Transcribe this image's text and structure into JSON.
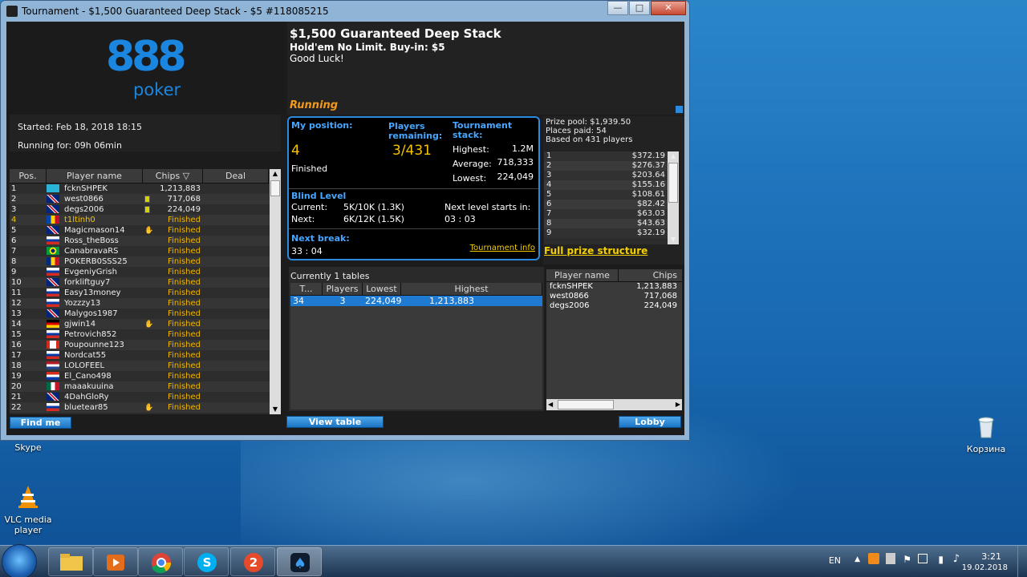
{
  "window": {
    "title": "Tournament - $1,500 Guaranteed Deep Stack - $5 #118085215",
    "minimize": "—",
    "maximize": "□",
    "close": "✕"
  },
  "logo": {
    "mark": "888",
    "word": "poker"
  },
  "tournament": {
    "name": "$1,500 Guaranteed Deep Stack",
    "game": "Hold'em No Limit. Buy-in: $5",
    "message": "Good Luck!",
    "state": "Running",
    "started": "Started: Feb 18, 2018 18:15",
    "running_for": "Running for: 09h 06min"
  },
  "player_list": {
    "headers": [
      "Pos.",
      "Player name",
      "Chips",
      "Deal"
    ],
    "rows": [
      {
        "pos": "1",
        "name": "fcknSHPEK",
        "chips": "1,213,883",
        "flag": "kz"
      },
      {
        "pos": "2",
        "name": "west0866",
        "chips": "717,068",
        "flag": "uk",
        "note": true
      },
      {
        "pos": "3",
        "name": "degs2006",
        "chips": "224,049",
        "flag": "uk",
        "note": true
      },
      {
        "pos": "4",
        "name": "t1ltinh0",
        "chips": "Finished",
        "flag": "md",
        "me": true
      },
      {
        "pos": "5",
        "name": "Magicmason14",
        "chips": "Finished",
        "flag": "uk",
        "deal": true
      },
      {
        "pos": "6",
        "name": "Ross_theBoss",
        "chips": "Finished",
        "flag": "ru"
      },
      {
        "pos": "7",
        "name": "CanabravaRS",
        "chips": "Finished",
        "flag": "br"
      },
      {
        "pos": "8",
        "name": "POKERB0SSS25",
        "chips": "Finished",
        "flag": "ro"
      },
      {
        "pos": "9",
        "name": "EvgeniyGrish",
        "chips": "Finished",
        "flag": "ru"
      },
      {
        "pos": "10",
        "name": "forkliftguy7",
        "chips": "Finished",
        "flag": "uk"
      },
      {
        "pos": "11",
        "name": "Easy13money",
        "chips": "Finished",
        "flag": "ru"
      },
      {
        "pos": "12",
        "name": "Yozzzy13",
        "chips": "Finished",
        "flag": "ru"
      },
      {
        "pos": "13",
        "name": "Malygos1987",
        "chips": "Finished",
        "flag": "uk"
      },
      {
        "pos": "14",
        "name": "gjwin14",
        "chips": "Finished",
        "flag": "de",
        "deal": true
      },
      {
        "pos": "15",
        "name": "Petrovich852",
        "chips": "Finished",
        "flag": "ru"
      },
      {
        "pos": "16",
        "name": "Poupounne123",
        "chips": "Finished",
        "flag": "ca"
      },
      {
        "pos": "17",
        "name": "Nordcat55",
        "chips": "Finished",
        "flag": "ru"
      },
      {
        "pos": "18",
        "name": "LOLOFEEL",
        "chips": "Finished",
        "flag": "nl"
      },
      {
        "pos": "19",
        "name": "El_Cano498",
        "chips": "Finished",
        "flag": "py"
      },
      {
        "pos": "20",
        "name": "maaakuuina",
        "chips": "Finished",
        "flag": "mx"
      },
      {
        "pos": "21",
        "name": "4DahGloRy",
        "chips": "Finished",
        "flag": "uk"
      },
      {
        "pos": "22",
        "name": "bluetear85",
        "chips": "Finished",
        "flag": "ru",
        "deal": true
      }
    ],
    "find_me": "Find me"
  },
  "status": {
    "my_position_label": "My position:",
    "my_position": "4",
    "my_status": "Finished",
    "players_remaining_label": "Players remaining:",
    "players_remaining": "3/431",
    "stack_label": "Tournament stack:",
    "highest_label": "Highest:",
    "highest": "1.2M",
    "average_label": "Average:",
    "average": "718,333",
    "lowest_label": "Lowest:",
    "lowest": "224,049",
    "blind_label": "Blind Level",
    "current_label": "Current:",
    "current": "5K/10K (1.3K)",
    "next_label": "Next:",
    "next": "6K/12K (1.5K)",
    "next_level_label": "Next level starts in:",
    "next_level": "03 : 03",
    "break_label": "Next break:",
    "break": "33 : 04",
    "info_link": "Tournament info"
  },
  "prize": {
    "pool": "Prize pool: $1,939.50",
    "places": "Places paid: 54",
    "based": "Based on 431 players",
    "rows": [
      {
        "p": "1",
        "v": "$372.19"
      },
      {
        "p": "2",
        "v": "$276.37"
      },
      {
        "p": "3",
        "v": "$203.64"
      },
      {
        "p": "4",
        "v": "$155.16"
      },
      {
        "p": "5",
        "v": "$108.61"
      },
      {
        "p": "6",
        "v": "$82.42"
      },
      {
        "p": "7",
        "v": "$63.03"
      },
      {
        "p": "8",
        "v": "$43.63"
      },
      {
        "p": "9",
        "v": "$32.19"
      }
    ],
    "full_link": "Full prize structure"
  },
  "tables": {
    "caption": "Currently 1 tables",
    "headers": [
      "T...",
      "Players",
      "Lowest",
      "Highest"
    ],
    "row": {
      "t": "34",
      "players": "3",
      "lowest": "224,049",
      "highest": "1,213,883"
    },
    "view_btn": "View table"
  },
  "table_players": {
    "headers": [
      "Player name",
      "Chips"
    ],
    "rows": [
      {
        "name": "fcknSHPEK",
        "chips": "1,213,883"
      },
      {
        "name": "west0866",
        "chips": "717,068"
      },
      {
        "name": "degs2006",
        "chips": "224,049"
      }
    ],
    "lobby_btn": "Lobby"
  },
  "desktop": {
    "skype": "Skype",
    "vlc": "VLC media player",
    "recycle": "Корзина"
  },
  "taskbar": {
    "lang": "EN",
    "time": "3:21",
    "date": "19.02.2018"
  }
}
